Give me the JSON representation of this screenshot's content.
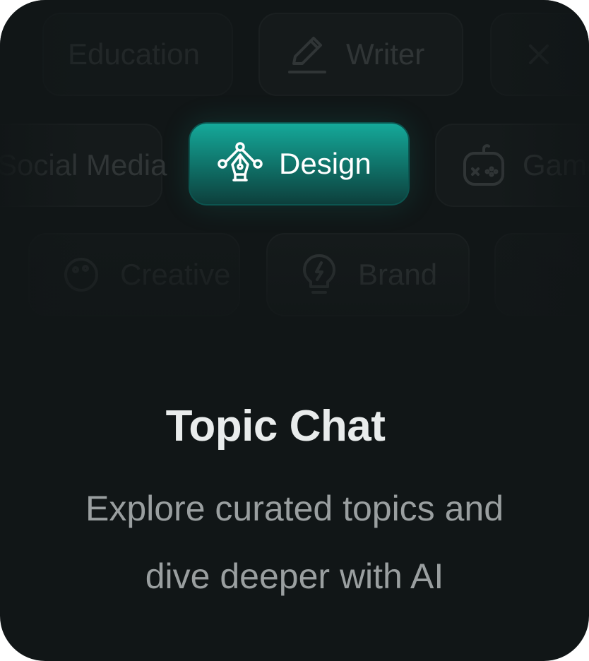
{
  "chips": {
    "education": "Education",
    "writer": "Writer",
    "social_media": "Social Media",
    "design": "Design",
    "games": "Games",
    "creative": "Creative",
    "brand": "Brand"
  },
  "icons": {
    "writer": "pencil-icon",
    "design": "vector-pen-icon",
    "games": "gamepad-icon",
    "brand": "lightbulb-icon",
    "creative": "palette-icon",
    "close": "close-icon"
  },
  "colors": {
    "background": "#111617",
    "accent": "#15a99a",
    "chip": "#191e1f"
  },
  "headline": {
    "title": "Topic Chat",
    "subtitle_line1": "Explore curated topics and",
    "subtitle_line2": "dive deeper with AI"
  }
}
